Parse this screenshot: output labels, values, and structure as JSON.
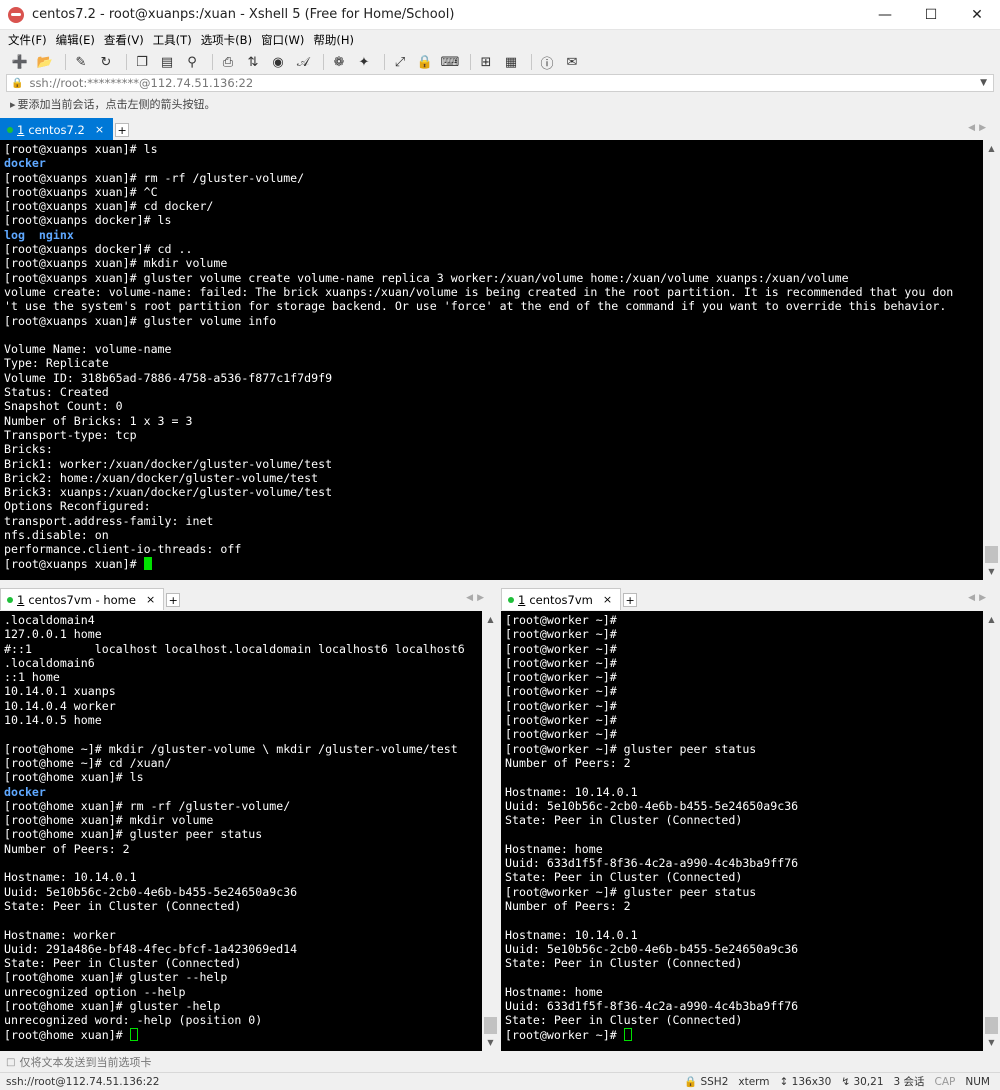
{
  "window": {
    "title": "centos7.2 - root@xuanps:/xuan - Xshell 5 (Free for Home/School)"
  },
  "menu": [
    "文件(F)",
    "编辑(E)",
    "查看(V)",
    "工具(T)",
    "选项卡(B)",
    "窗口(W)",
    "帮助(H)"
  ],
  "address": {
    "value": "ssh://root:*********@112.74.51.136:22"
  },
  "hint": "要添加当前会话，点击左侧的箭头按钮。",
  "tabs": {
    "top": {
      "num": "1",
      "label": "centos7.2"
    },
    "bottom_left": {
      "num": "1",
      "label": "centos7vm - home"
    },
    "bottom_right": {
      "num": "1",
      "label": "centos7vm"
    }
  },
  "terminals": {
    "top": [
      "[root@xuanps xuan]# ls",
      "docker",
      "[root@xuanps xuan]# rm -rf /gluster-volume/",
      "[root@xuanps xuan]# ^C",
      "[root@xuanps xuan]# cd docker/",
      "[root@xuanps docker]# ls",
      "log  nginx",
      "[root@xuanps docker]# cd ..",
      "[root@xuanps xuan]# mkdir volume",
      "[root@xuanps xuan]# gluster volume create volume-name replica 3 worker:/xuan/volume home:/xuan/volume xuanps:/xuan/volume",
      "volume create: volume-name: failed: The brick xuanps:/xuan/volume is being created in the root partition. It is recommended that you don",
      "'t use the system's root partition for storage backend. Or use 'force' at the end of the command if you want to override this behavior.",
      "[root@xuanps xuan]# gluster volume info",
      "",
      "Volume Name: volume-name",
      "Type: Replicate",
      "Volume ID: 318b65ad-7886-4758-a536-f877c1f7d9f9",
      "Status: Created",
      "Snapshot Count: 0",
      "Number of Bricks: 1 x 3 = 3",
      "Transport-type: tcp",
      "Bricks:",
      "Brick1: worker:/xuan/docker/gluster-volume/test",
      "Brick2: home:/xuan/docker/gluster-volume/test",
      "Brick3: xuanps:/xuan/docker/gluster-volume/test",
      "Options Reconfigured:",
      "transport.address-family: inet",
      "nfs.disable: on",
      "performance.client-io-threads: off",
      "[root@xuanps xuan]# "
    ],
    "bottom_left": [
      ".localdomain4",
      "127.0.0.1 home",
      "#::1         localhost localhost.localdomain localhost6 localhost6",
      ".localdomain6",
      "::1 home",
      "10.14.0.1 xuanps",
      "10.14.0.4 worker",
      "10.14.0.5 home",
      "",
      "[root@home ~]# mkdir /gluster-volume \\ mkdir /gluster-volume/test",
      "[root@home ~]# cd /xuan/",
      "[root@home xuan]# ls",
      "docker",
      "[root@home xuan]# rm -rf /gluster-volume/",
      "[root@home xuan]# mkdir volume",
      "[root@home xuan]# gluster peer status",
      "Number of Peers: 2",
      "",
      "Hostname: 10.14.0.1",
      "Uuid: 5e10b56c-2cb0-4e6b-b455-5e24650a9c36",
      "State: Peer in Cluster (Connected)",
      "",
      "Hostname: worker",
      "Uuid: 291a486e-bf48-4fec-bfcf-1a423069ed14",
      "State: Peer in Cluster (Connected)",
      "[root@home xuan]# gluster --help",
      "unrecognized option --help",
      "[root@home xuan]# gluster -help",
      "unrecognized word: -help (position 0)",
      "[root@home xuan]# "
    ],
    "bottom_right": [
      "[root@worker ~]#",
      "[root@worker ~]#",
      "[root@worker ~]#",
      "[root@worker ~]#",
      "[root@worker ~]#",
      "[root@worker ~]#",
      "[root@worker ~]#",
      "[root@worker ~]#",
      "[root@worker ~]#",
      "[root@worker ~]# gluster peer status",
      "Number of Peers: 2",
      "",
      "Hostname: 10.14.0.1",
      "Uuid: 5e10b56c-2cb0-4e6b-b455-5e24650a9c36",
      "State: Peer in Cluster (Connected)",
      "",
      "Hostname: home",
      "Uuid: 633d1f5f-8f36-4c2a-a990-4c4b3ba9ff76",
      "State: Peer in Cluster (Connected)",
      "[root@worker ~]# gluster peer status",
      "Number of Peers: 2",
      "",
      "Hostname: 10.14.0.1",
      "Uuid: 5e10b56c-2cb0-4e6b-b455-5e24650a9c36",
      "State: Peer in Cluster (Connected)",
      "",
      "Hostname: home",
      "Uuid: 633d1f5f-8f36-4c2a-a990-4c4b3ba9ff76",
      "State: Peer in Cluster (Connected)",
      "[root@worker ~]# "
    ]
  },
  "sendbar": "仅将文本发送到当前选项卡",
  "status": {
    "connection": "ssh://root@112.74.51.136:22",
    "protocol": "SSH2",
    "terminal": "xterm",
    "size": "136x30",
    "cursor": "30,21",
    "sessions": "3 会话",
    "cap": "CAP",
    "num": "NUM"
  },
  "colors": {
    "terminal_bg": "#000000",
    "terminal_fg": "#ffffff",
    "directory": "#5fa8ff",
    "cursor": "#00e000",
    "active_tab": "#0078d7",
    "tab_dot": "#1fbf3a"
  },
  "icons": [
    "new-session-icon",
    "open-folder-icon",
    "properties-icon",
    "copy-icon",
    "paste-icon",
    "find-icon",
    "print-icon",
    "transfer-icon",
    "globe-icon",
    "font-icon",
    "xftp-icon",
    "xmanager-icon",
    "fullscreen-icon",
    "lock-icon",
    "keyboard-icon",
    "new-tab-icon",
    "layout-icon",
    "help-icon",
    "chat-icon"
  ]
}
